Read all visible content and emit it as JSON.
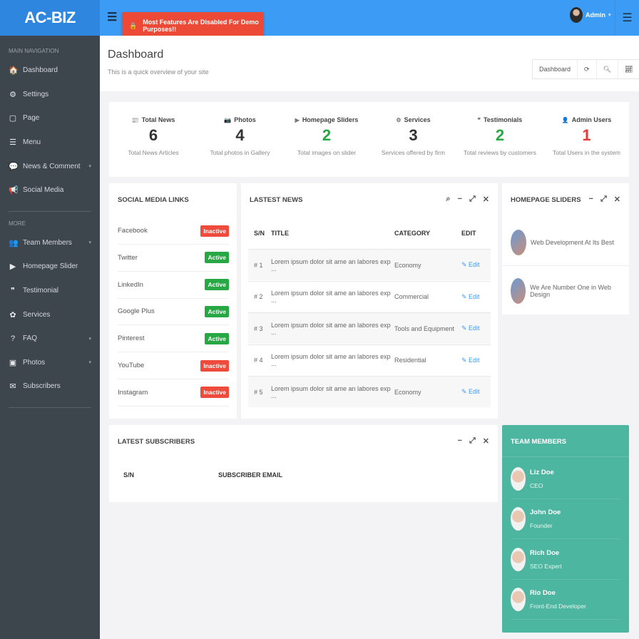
{
  "header": {
    "logo": "AC-BIZ",
    "menu_icon": "☰",
    "demo_notice": "Most Features Are Disabled For Demo Purposes!!",
    "user": "Admin"
  },
  "sidebar": {
    "main_label": "MAIN NAVIGATION",
    "main_items": [
      {
        "icon": "🏠",
        "label": "Dashboard"
      },
      {
        "icon": "⚙",
        "label": "Settings"
      },
      {
        "icon": "▢",
        "label": "Page"
      },
      {
        "icon": "☰",
        "label": "Menu"
      },
      {
        "icon": "💬",
        "label": "News & Comment",
        "caret": "▾"
      },
      {
        "icon": "📢",
        "label": "Social Media"
      }
    ],
    "more_label": "MORE",
    "more_items": [
      {
        "icon": "👥",
        "label": "Team Members",
        "caret": "▾"
      },
      {
        "icon": "▶",
        "label": "Homepage Slider"
      },
      {
        "icon": "❞",
        "label": "Testimonial"
      },
      {
        "icon": "✿",
        "label": "Services"
      },
      {
        "icon": "?",
        "label": "FAQ",
        "caret": "▾"
      },
      {
        "icon": "▣",
        "label": "Photos",
        "caret": "▾"
      },
      {
        "icon": "✉",
        "label": "Subscribers"
      }
    ]
  },
  "page": {
    "title": "Dashboard",
    "subtitle": "This is a quick overview of your site",
    "breadcrumb": "Dashboard"
  },
  "stats": [
    {
      "icon": "📰",
      "label": "Total News",
      "value": "6",
      "sub": "Total News Articles",
      "color": "#333333"
    },
    {
      "icon": "📷",
      "label": "Photos",
      "value": "4",
      "sub": "Total photos in Gallery",
      "color": "#333333"
    },
    {
      "icon": "▶",
      "label": "Homepage Sliders",
      "value": "2",
      "sub": "Total images on slider",
      "color": "#28a745"
    },
    {
      "icon": "⚙",
      "label": "Services",
      "value": "3",
      "sub": "Services offered by firm",
      "color": "#333333"
    },
    {
      "icon": "❞",
      "label": "Testimonials",
      "value": "2",
      "sub": "Total reviews by customers",
      "color": "#28a745"
    },
    {
      "icon": "👤",
      "label": "Admin Users",
      "value": "1",
      "sub": "Total Users in the system",
      "color": "#e53935"
    }
  ],
  "social": {
    "title": "SOCIAL MEDIA LINKS",
    "items": [
      {
        "name": "Facebook",
        "status": "Inactive"
      },
      {
        "name": "Twitter",
        "status": "Active"
      },
      {
        "name": "LinkedIn",
        "status": "Active"
      },
      {
        "name": "Google Plus",
        "status": "Active"
      },
      {
        "name": "Pinterest",
        "status": "Active"
      },
      {
        "name": "YouTube",
        "status": "Inactive"
      },
      {
        "name": "Instagram",
        "status": "Inactive"
      }
    ]
  },
  "news": {
    "title": "LASTEST NEWS",
    "headers": [
      "S/N",
      "TITLE",
      "CATEGORY",
      "EDIT"
    ],
    "rows": [
      {
        "sn": "# 1",
        "title": "Lorem ipsum dolor sit ame an labores exp ...",
        "category": "Economy",
        "edit": "✎ Edit"
      },
      {
        "sn": "# 2",
        "title": "Lorem ipsum dolor sit ame an labores exp ...",
        "category": "Commercial",
        "edit": "✎ Edit"
      },
      {
        "sn": "# 3",
        "title": "Lorem ipsum dolor sit ame an labores exp ...",
        "category": "Tools and Equipment",
        "edit": "✎ Edit"
      },
      {
        "sn": "# 4",
        "title": "Lorem ipsum dolor sit ame an labores exp ...",
        "category": "Residential",
        "edit": "✎ Edit"
      },
      {
        "sn": "# 5",
        "title": "Lorem ipsum dolor sit ame an labores exp ...",
        "category": "Economy",
        "edit": "✎ Edit"
      }
    ]
  },
  "sliders": {
    "title": "HOMEPAGE SLIDERS",
    "items": [
      "Web Development At Its Best",
      "We Are Number One in Web Design"
    ]
  },
  "subscribers": {
    "title": "LATEST SUBSCRIBERS",
    "headers": [
      "S/N",
      "SUBSCRIBER EMAIL"
    ]
  },
  "team": {
    "title": "TEAM MEMBERS",
    "members": [
      {
        "name": "Liz Doe",
        "role": "CEO"
      },
      {
        "name": "John Doe",
        "role": "Founder"
      },
      {
        "name": "Rich Doe",
        "role": "SEO Expert"
      },
      {
        "name": "Rio Doe",
        "role": "Front-End Developer"
      }
    ]
  },
  "colors": {
    "active": "#28a745",
    "inactive": "#ef4b3c",
    "team_bg": "#4db6a0",
    "header": "#3b9bf5"
  }
}
